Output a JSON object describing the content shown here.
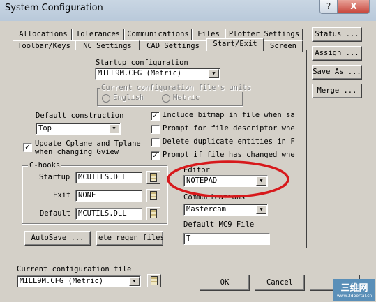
{
  "window": {
    "title": "System Configuration",
    "help_label": "?",
    "close_label": "X"
  },
  "tabs_row1": [
    "Allocations",
    "Tolerances",
    "Communications",
    "Files",
    "Plotter Settings"
  ],
  "tabs_row2": [
    "Toolbar/Keys",
    "NC Settings",
    "CAD Settings",
    "Start/Exit",
    "Screen"
  ],
  "active_tab": "Start/Exit",
  "right_buttons": [
    "Status ...",
    "Assign ...",
    "Save As ...",
    "Merge ..."
  ],
  "startup_config": {
    "label": "Startup configuration",
    "value": "MILL9M.CFG (Metric)",
    "units_group_title": "Current configuration file's units",
    "radio_english": "English",
    "radio_metric": "Metric"
  },
  "default_construction": {
    "label": "Default construction",
    "value": "Top"
  },
  "update_cplane": {
    "line1": "Update Cplane and Tplane",
    "line2": "when changing Gview",
    "checked": true
  },
  "options": [
    {
      "label": "Include bitmap in file when savi",
      "checked": true
    },
    {
      "label": "Prompt for file descriptor when",
      "checked": false
    },
    {
      "label": "Delete duplicate entities in Fil",
      "checked": false
    },
    {
      "label": "Prompt if file has changed when",
      "checked": true
    }
  ],
  "chooks": {
    "title": "C-hooks",
    "startup_label": "Startup",
    "startup_value": "MCUTILS.DLL",
    "exit_label": "Exit",
    "exit_value": "NONE",
    "default_label": "Default",
    "default_value": "MCUTILS.DLL"
  },
  "editor": {
    "label": "Editor",
    "value": "NOTEPAD"
  },
  "communications": {
    "label": "Communications",
    "value": "Mastercam"
  },
  "default_mc9": {
    "label": "Default MC9 File",
    "value": "T"
  },
  "autosave_label": "AutoSave ...",
  "regen_label": "ete regen files",
  "current_config": {
    "label": "Current configuration file",
    "value": "MILL9M.CFG (Metric)"
  },
  "bottom_buttons": {
    "ok": "OK",
    "cancel": "Cancel",
    "help": "H"
  },
  "watermark": {
    "main": "三维网",
    "sub": "www.3dportal.cn"
  },
  "colors": {
    "highlight_ellipse": "#d7191c",
    "dialog_face": "#d4d0c8"
  }
}
